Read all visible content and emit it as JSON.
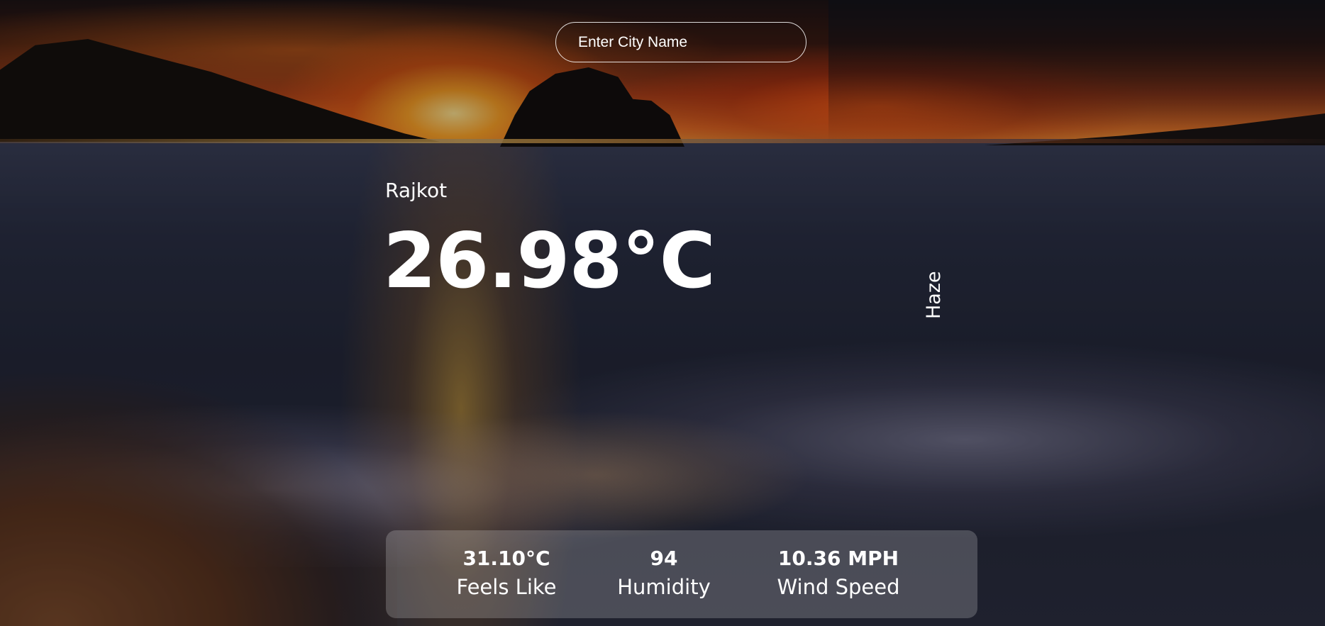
{
  "search": {
    "placeholder": "Enter City Name"
  },
  "weather": {
    "city": "Rajkot",
    "temperature": "26.98°C",
    "condition": "Haze"
  },
  "stats": {
    "feels_like": {
      "value": "31.10°C",
      "label": "Feels Like"
    },
    "humidity": {
      "value": "94",
      "label": "Humidity"
    },
    "wind_speed": {
      "value": "10.36 MPH",
      "label": "Wind Speed"
    }
  },
  "colors": {
    "text": "#ffffff",
    "panel": "rgba(255,255,255,0.2)",
    "background_theme": "sunset-beach"
  }
}
